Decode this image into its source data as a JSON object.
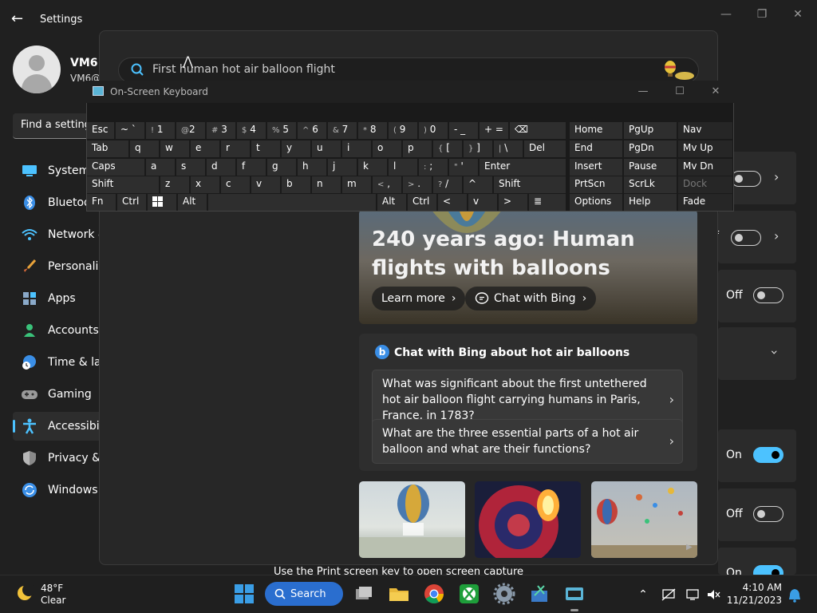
{
  "settings": {
    "title": "Settings",
    "user": {
      "name": "VM6",
      "sub": "VM6@"
    },
    "find_placeholder": "Find a setting",
    "nav": [
      {
        "label": "System",
        "icon": "monitor-icon"
      },
      {
        "label": "Bluetooth & devices",
        "icon": "bluetooth-icon"
      },
      {
        "label": "Network & internet",
        "icon": "wifi-icon"
      },
      {
        "label": "Personalization",
        "icon": "brush-icon"
      },
      {
        "label": "Apps",
        "icon": "apps-icon"
      },
      {
        "label": "Accounts",
        "icon": "person-icon"
      },
      {
        "label": "Time & language",
        "icon": "clock-globe-icon"
      },
      {
        "label": "Gaming",
        "icon": "gamepad-icon"
      },
      {
        "label": "Accessibility",
        "icon": "accessibility-icon"
      },
      {
        "label": "Privacy & security",
        "icon": "shield-icon"
      },
      {
        "label": "Windows Update",
        "icon": "update-icon"
      }
    ],
    "right_states": {
      "off_partial": "f",
      "off": "Off",
      "on1": "On",
      "off2": "Off",
      "on2": "On"
    },
    "bottom_text": "Use the Print screen key to open screen capture"
  },
  "search": {
    "query": "First human hot air balloon flight",
    "hero": {
      "title": "240 years ago: Human flights with balloons",
      "learn_more": "Learn more",
      "chat_with_bing": "Chat with Bing"
    },
    "chat_card": {
      "title": "Chat with Bing about hot air balloons",
      "questions": [
        "What was significant about the first untethered hot air balloon flight carrying humans in Paris, France, in 1783?",
        "What are the three essential parts of a hot air balloon and what are their functions?"
      ]
    }
  },
  "osk": {
    "title": "On-Screen Keyboard",
    "rows": {
      "r1": {
        "esc": "Esc",
        "tilde": "~ `",
        "k1": "1",
        "k1s": "!",
        "k2": "2",
        "k2s": "@",
        "k3": "3",
        "k3s": "#",
        "k4": "4",
        "k4s": "$",
        "k5": "5",
        "k5s": "%",
        "k6": "6",
        "k6s": "^",
        "k7": "7",
        "k7s": "&",
        "k8": "8",
        "k8s": "*",
        "k9": "9",
        "k9s": "(",
        "k0": "0",
        "k0s": ")",
        "minus": "- _",
        "plus": "+ =",
        "bksp": "⌫"
      },
      "r2": {
        "tab": "Tab",
        "q": "q",
        "w": "w",
        "e": "e",
        "r": "r",
        "t": "t",
        "y": "y",
        "u": "u",
        "i": "i",
        "o": "o",
        "p": "p",
        "lbr": "[",
        "lbrs": "{",
        "rbr": "]",
        "rbrs": "}",
        "pipe": "\\",
        "pipes": "|",
        "del": "Del"
      },
      "r3": {
        "caps": "Caps",
        "a": "a",
        "s": "s",
        "d": "d",
        "f": "f",
        "g": "g",
        "h": "h",
        "j": "j",
        "k": "k",
        "l": "l",
        "semi": ";",
        "semis": ":",
        "quote": "'",
        "quotes": "\"",
        "enter": "Enter"
      },
      "r4": {
        "shift": "Shift",
        "z": "z",
        "x": "x",
        "c": "c",
        "v": "v",
        "b": "b",
        "n": "n",
        "m": "m",
        "comma": ",",
        "commas": "<",
        "period": ".",
        "periods": ">",
        "slash": "/",
        "slashs": "?",
        "up": "^",
        "shift2": "Shift"
      },
      "r5": {
        "fn": "Fn",
        "ctrl": "Ctrl",
        "alt": "Alt",
        "alt2": "Alt",
        "ctrl2": "Ctrl",
        "left": "<",
        "down": "v",
        "right": ">",
        "menu": "≣"
      }
    },
    "right_keys": [
      [
        "Home",
        "PgUp",
        "Nav"
      ],
      [
        "End",
        "PgDn",
        "Mv Up"
      ],
      [
        "Insert",
        "Pause",
        "Mv Dn"
      ],
      [
        "PrtScn",
        "ScrLk",
        "Dock"
      ],
      [
        "Options",
        "Help",
        "Fade"
      ]
    ]
  },
  "taskbar": {
    "weather_temp": "48°F",
    "weather_desc": "Clear",
    "search_label": "Search",
    "time": "4:10 AM",
    "date": "11/21/2023"
  },
  "colors": {
    "accent": "#4cc2ff",
    "search_button": "#2a6ecf",
    "bing_blue": "#3a8ee6"
  }
}
